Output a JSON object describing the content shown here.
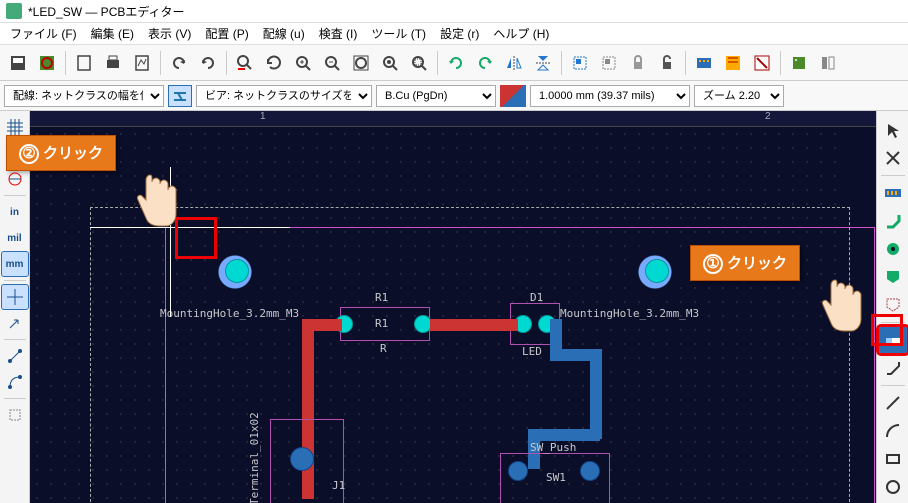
{
  "window": {
    "title": "*LED_SW — PCBエディター"
  },
  "menu": {
    "file": "ファイル (F)",
    "edit": "編集 (E)",
    "view": "表示 (V)",
    "place": "配置 (P)",
    "route": "配線 (u)",
    "inspect": "検査 (I)",
    "tools": "ツール (T)",
    "prefs": "設定 (r)",
    "help": "ヘルプ (H)"
  },
  "optbar": {
    "track_label": "配線: ネットクラスの幅を使用",
    "via_label": "ビア: ネットクラスのサイズを使用",
    "layer_label": "B.Cu (PgDn)",
    "grid_label": "1.0000 mm (39.37 mils)",
    "zoom_label": "ズーム 2.20"
  },
  "lefttools": {
    "in": "in",
    "mil": "mil",
    "mm": "mm"
  },
  "callouts": {
    "c1": {
      "num": "①",
      "text": "クリック"
    },
    "c2": {
      "num": "②",
      "text": "クリック"
    }
  },
  "ruler": {
    "t1": "1",
    "t2": "2"
  },
  "silk": {
    "mh1": "MountingHole_3.2mm_M3",
    "mh2": "MountingHole_3.2mm_M3",
    "r1": "R1",
    "r1b": "R1",
    "r": "R",
    "d1": "D1",
    "led": "LED",
    "sw_push": "SW_Push",
    "sw1": "SW1",
    "j1": "J1",
    "term": "Terminal_01x02"
  },
  "chart_data": null
}
